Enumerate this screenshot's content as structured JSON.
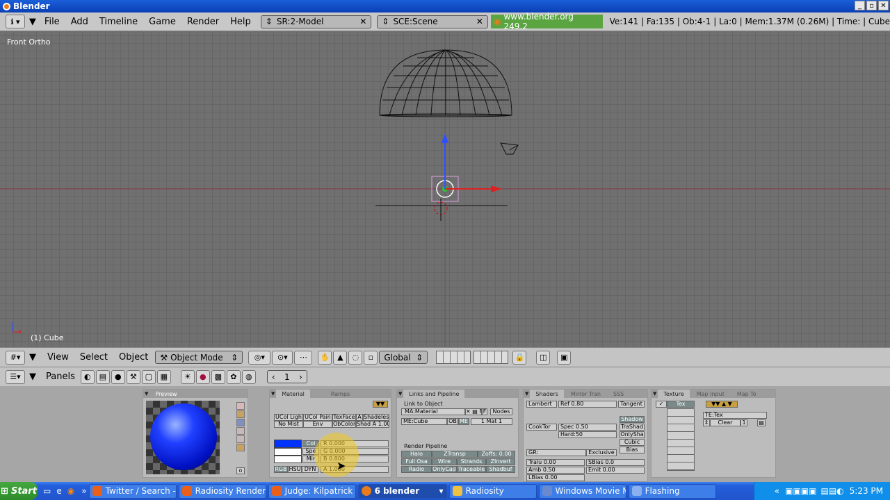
{
  "window": {
    "title": "Blender",
    "buttons": [
      "_",
      "▫",
      "✕"
    ]
  },
  "menubar": {
    "items": [
      "File",
      "Add",
      "Timeline",
      "Game",
      "Render",
      "Help"
    ],
    "screen": "SR:2-Model",
    "scene": "SCE:Scene",
    "url": "www.blender.org 249.2",
    "stats": "Ve:141 | Fa:135 | Ob:4-1 | La:0  | Mem:1.37M (0.26M)  | Time: | Cube"
  },
  "viewport": {
    "view_label": "Front Ortho",
    "object_label": "(1) Cube"
  },
  "view_header": {
    "menus": [
      "View",
      "Select",
      "Object"
    ],
    "mode": "Object Mode",
    "orientation": "Global"
  },
  "buttons_header": {
    "panels_label": "Panels",
    "frame": "1"
  },
  "preview": {
    "tab": "Preview"
  },
  "material": {
    "tabs": [
      "Material",
      "Ramps"
    ],
    "buttons": [
      "UCol Ligh",
      "UCol Pain",
      "TexFace",
      "A",
      "Shadeles",
      "No Mist",
      "Env",
      "ObColor",
      "Shad A 1.00"
    ],
    "color_tabs": [
      "Col",
      "Spe",
      "Mir"
    ],
    "sliders": [
      "R 0.000",
      "G 0.000",
      "B 0.800"
    ],
    "modes": [
      "RGB",
      "HSU",
      "DYN"
    ],
    "alpha": "A 1.000",
    "col_color": "#0033ff"
  },
  "links": {
    "tab": "Links and Pipeline",
    "link_label": "Link to Object",
    "material_name": "MA:Material",
    "mesh_name": "ME:Cube",
    "ob": "OB",
    "me": "ME",
    "mat_count": "1 Mat 1",
    "nodes": "Nodes",
    "f": "F",
    "pipeline_label": "Render Pipeline",
    "pipeline": [
      "Halo",
      "ZTransp",
      "Zoffs: 0.00",
      "Full Osa",
      "Wire",
      "Strands",
      "ZInvert",
      "Radio",
      "OnlyCast",
      "Traceable",
      "Shadbuf"
    ]
  },
  "shaders": {
    "tabs": [
      "Shaders",
      "Mirror Tran",
      "SSS"
    ],
    "diffuse": "Lambert",
    "ref": "Ref  0.80",
    "tangent": "Tangent",
    "specular": "CookTor",
    "spec": "Spec 0.50",
    "hard": "Hard:50",
    "toggles": [
      "Shadow",
      "TraShad",
      "OnlySha",
      "Cubic",
      "Bias"
    ],
    "gr": "GR:",
    "exclusive": "Exclusive",
    "tralu": "Tralu 0.00",
    "sbias": "SBias 0.0",
    "amb": "Amb 0.50",
    "emit": "Emit 0.00",
    "lbias": "LBias 0.00"
  },
  "texture": {
    "tabs": [
      "Texture",
      "Map Input",
      "Map To"
    ],
    "slot": "Tex",
    "te": "TE:Tex",
    "clear": "Clear",
    "users": "1"
  },
  "taskbar": {
    "start": "Start",
    "tasks": [
      "Twitter / Search - ...",
      "Radiosity Renderi...",
      "Judge: Kilpatrick h...",
      "6 blender",
      "Radiosity",
      "Windows Movie M...",
      "Flashing"
    ],
    "clock": "5:23 PM",
    "more": "»"
  }
}
